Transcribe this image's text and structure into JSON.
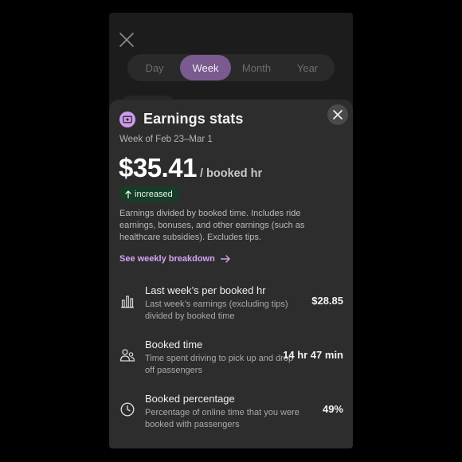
{
  "tabs": [
    {
      "label": "Day",
      "active": false
    },
    {
      "label": "Week",
      "active": true
    },
    {
      "label": "Month",
      "active": false
    },
    {
      "label": "Year",
      "active": false
    }
  ],
  "sheet": {
    "title": "Earnings stats",
    "title_icon": "money-icon",
    "subtitle": "Week of Feb 23–Mar 1",
    "amount": "$35.41",
    "unit": "/ booked hr",
    "badge": "increased",
    "badge_color": "#173d26",
    "description": "Earnings divided by booked time. Includes ride earnings, bonuses, and other earnings (such as healthcare subsidies). Excludes tips.",
    "link_label": "See weekly breakdown",
    "accent": "#d3a4f4"
  },
  "stats": [
    {
      "icon": "bar-chart-icon",
      "title": "Last week’s per booked hr",
      "desc": "Last week’s earnings (excluding tips) divided by booked time",
      "value": "$28.85"
    },
    {
      "icon": "passenger-icon",
      "title": "Booked time",
      "desc": "Time spent driving to pick up and drop off passengers",
      "value": "14 hr 47 min"
    },
    {
      "icon": "clock-icon",
      "title": "Booked percentage",
      "desc": "Percentage of online time that you were booked with passengers",
      "value": "49%"
    }
  ]
}
